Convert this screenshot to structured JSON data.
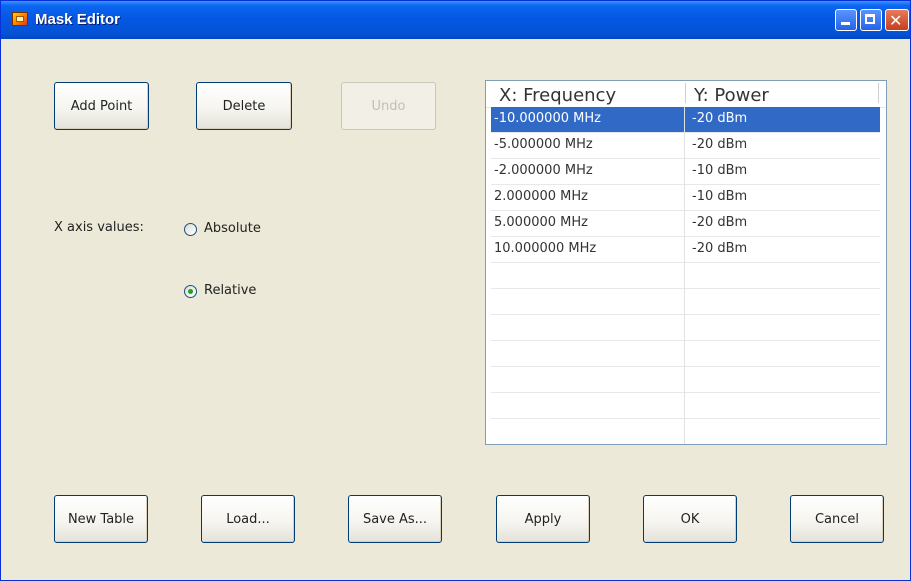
{
  "window": {
    "title": "Mask Editor"
  },
  "toolbar": {
    "add_point": "Add Point",
    "delete": "Delete",
    "undo": "Undo"
  },
  "x_axis": {
    "label": "X axis values:",
    "options": [
      {
        "label": "Absolute",
        "selected": false
      },
      {
        "label": "Relative",
        "selected": true
      }
    ]
  },
  "table": {
    "headers": [
      "X: Frequency",
      "Y: Power"
    ],
    "rows": [
      {
        "x": "-10.000000 MHz",
        "y": "-20 dBm",
        "selected": true
      },
      {
        "x": "-5.000000 MHz",
        "y": "-20 dBm",
        "selected": false
      },
      {
        "x": "-2.000000 MHz",
        "y": "-10 dBm",
        "selected": false
      },
      {
        "x": "2.000000 MHz",
        "y": "-10 dBm",
        "selected": false
      },
      {
        "x": "5.000000 MHz",
        "y": "-20 dBm",
        "selected": false
      },
      {
        "x": "10.000000 MHz",
        "y": "-20 dBm",
        "selected": false
      }
    ]
  },
  "footer": {
    "new_table": "New Table",
    "load": "Load...",
    "save_as": "Save As...",
    "apply": "Apply",
    "ok": "OK",
    "cancel": "Cancel"
  },
  "colors": {
    "selection": "#3169c6",
    "titlebar": "#0556e2",
    "radio_dot": "#21a121"
  }
}
